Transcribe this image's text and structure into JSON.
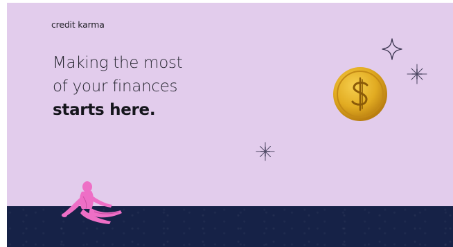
{
  "brand": {
    "logo_text": "credit karma"
  },
  "headline": {
    "line1": "Making the most",
    "line2": "of your finances",
    "line3": "starts here."
  },
  "colors": {
    "background": "#e2ccec",
    "footer": "#162247",
    "coin": "#e6b328",
    "figure": "#ee6fc6",
    "text": "#262630"
  },
  "icons": [
    "diamond-sparkle-icon",
    "star-sparkle-icon",
    "dollar-coin-icon",
    "person-figure-illustration"
  ]
}
